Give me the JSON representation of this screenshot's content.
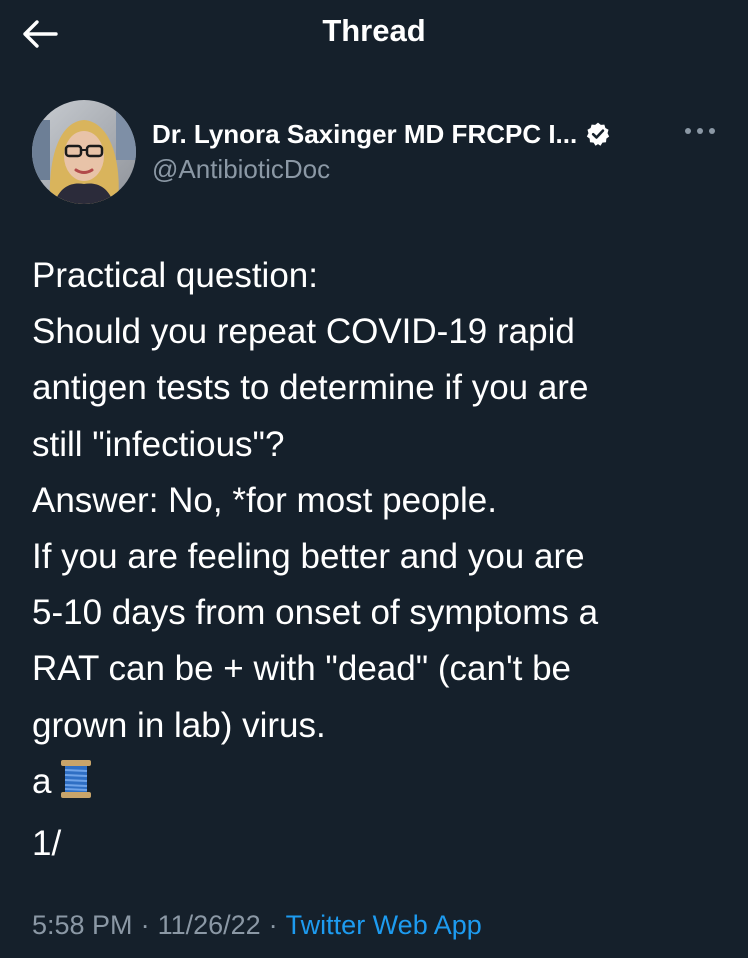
{
  "header": {
    "title": "Thread",
    "back_icon": "arrow-left-icon"
  },
  "author": {
    "display_name": "Dr. Lynora Saxinger MD FRCPC I...",
    "handle": "@AntibioticDoc",
    "verified_icon": "verified-badge-icon",
    "more_icon": "more-horizontal-icon"
  },
  "tweet": {
    "lines": [
      "Practical question:",
      "Should you repeat COVID-19 rapid",
      "antigen tests to determine if you are",
      "still \"infectious\"?",
      "Answer: No, *for most people.",
      "If you are feeling better and you are",
      "5-10 days from onset of symptoms a",
      "RAT can be + with \"dead\" (can't be",
      "grown in lab) virus.",
      "a",
      "1/"
    ],
    "thread_emoji_icon": "spool-of-thread-icon"
  },
  "meta": {
    "time": "5:58 PM",
    "date": "11/26/22",
    "separator": "·",
    "source": "Twitter Web App"
  },
  "colors": {
    "background": "#15202b",
    "text": "#ffffff",
    "secondary": "#8b98a5",
    "accent": "#1d9bf0"
  }
}
